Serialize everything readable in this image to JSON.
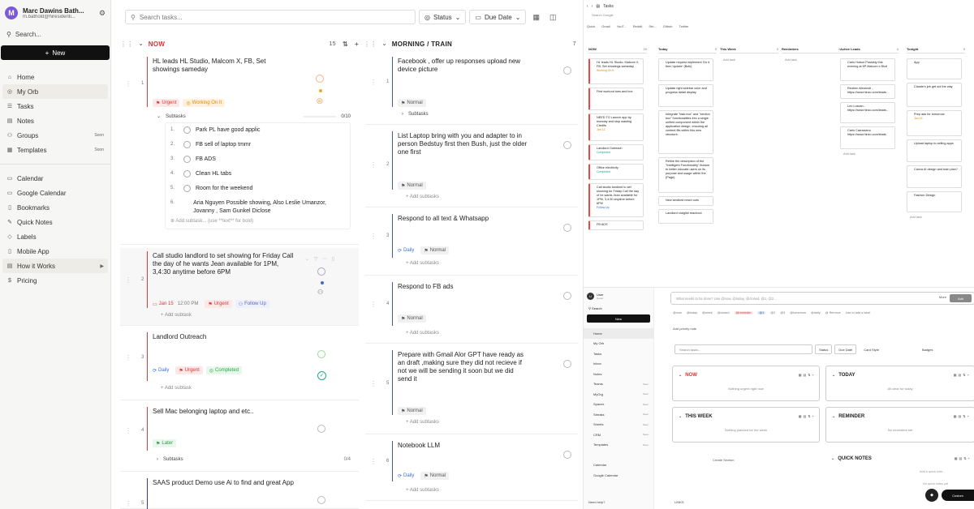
{
  "sidebar": {
    "avatar_letter": "M",
    "user_name": "Marc Dawins Bath...",
    "user_email": "m.bathold@hiresidenti...",
    "search_label": "Search...",
    "new_label": "New",
    "nav1": [
      {
        "label": "Home",
        "icon": "home-icon",
        "glyph": "⌂",
        "tag": ""
      },
      {
        "label": "My Orb",
        "icon": "orb-icon",
        "glyph": "◎",
        "tag": "",
        "active": true
      },
      {
        "label": "Tasks",
        "icon": "tasks-icon",
        "glyph": "☰",
        "tag": ""
      },
      {
        "label": "Notes",
        "icon": "notes-icon",
        "glyph": "▤",
        "tag": ""
      },
      {
        "label": "Groups",
        "icon": "groups-icon",
        "glyph": "⚇",
        "tag": "Soon"
      },
      {
        "label": "Templates",
        "icon": "templates-icon",
        "glyph": "▦",
        "tag": "Soon"
      }
    ],
    "nav2": [
      {
        "label": "Calendar",
        "icon": "calendar-icon",
        "glyph": "▭"
      },
      {
        "label": "Google Calendar",
        "icon": "google-calendar-icon",
        "glyph": "▭"
      },
      {
        "label": "Bookmarks",
        "icon": "bookmark-icon",
        "glyph": "▯"
      },
      {
        "label": "Quick Notes",
        "icon": "quick-notes-icon",
        "glyph": "✎"
      },
      {
        "label": "Labels",
        "icon": "label-icon",
        "glyph": "◇"
      },
      {
        "label": "Mobile App",
        "icon": "mobile-icon",
        "glyph": "▯"
      },
      {
        "label": "How it Works",
        "icon": "book-icon",
        "glyph": "▤",
        "active": true
      },
      {
        "label": "Pricing",
        "icon": "pricing-icon",
        "glyph": "$"
      }
    ]
  },
  "toolbar": {
    "search_placeholder": "Search tasks...",
    "status_label": "Status",
    "due_label": "Due Date"
  },
  "now_col": {
    "title": "NOW",
    "count": "15",
    "cards": [
      {
        "num": "1",
        "title": "HL leads HL Studio, Malcom X, FB, Set showings sameday",
        "urgent": "Urgent",
        "working": "Working On It",
        "subtasks_label": "Subtasks",
        "subtasks_progress": "0/10"
      },
      {
        "num": "2",
        "title": "Call studio landlord to set showing for Friday Call the day of he wants Jean available for 1PM, 3,4:30 anytime before 6PM",
        "date": "Jan 15",
        "time": "12:00 PM",
        "urgent": "Urgent",
        "follow": "Follow Up",
        "add": "Add subtask"
      },
      {
        "num": "3",
        "title": "Landlord Outreach",
        "daily": "Daily",
        "urgent": "Urgent",
        "completed": "Completed",
        "add": "Add subtask"
      },
      {
        "num": "4",
        "title": "Sell Mac belonging laptop and etc..",
        "later": "Later",
        "subtasks_label": "Subtasks",
        "subtasks_progress": "0/4"
      },
      {
        "num": "5",
        "title": "SAAS product Demo use Ai to find and great App"
      }
    ],
    "subtasks": [
      {
        "n": "1.",
        "t": "Park PL have good applic"
      },
      {
        "n": "2.",
        "t": "FB sell of laptop tmmr"
      },
      {
        "n": "3.",
        "t": "FB ADS"
      },
      {
        "n": "4.",
        "t": "Clean HL tabs"
      },
      {
        "n": "5.",
        "t": "Room for the weekend"
      },
      {
        "n": "6.",
        "t": "Aria Nguyen Possible showing, Also Leslie Umanzor,  Jovanny , Sam Gunkel Diclose"
      }
    ],
    "add_subtask_placeholder": "Add subtask... (use **text** for bold)"
  },
  "morning_col": {
    "title": "MORNING / TRAIN",
    "count": "7",
    "cards": [
      {
        "num": "1",
        "title": "Facebook , offer up responses upload new device picture",
        "normal": "Normal",
        "subtasks_label": "Subtasks"
      },
      {
        "num": "2",
        "title": "List Laptop bring with you and adapter to in person Bedstuy first then Bush, just the older one first",
        "normal": "Normal",
        "add": "Add subtasks"
      },
      {
        "num": "3",
        "title": "Respond to all text & Whatsapp",
        "daily": "Daily",
        "normal": "Normal",
        "add": "Add subtasks"
      },
      {
        "num": "4",
        "title": "Respond to FB ads",
        "normal": "Normal",
        "add": "Add subtasks"
      },
      {
        "num": "5",
        "title": "Prepare with Gmail Alor GPT have ready as an draft ,making sure they did not recieve if not we will be sending it soon but we did send it",
        "normal": "Normal",
        "add": "Add subtasks"
      },
      {
        "num": "6",
        "title": "Notebook LLM",
        "daily": "Daily",
        "normal": "Normal",
        "add": "Add subtasks"
      }
    ]
  },
  "board_shot": {
    "title": "Tasks",
    "search": "Search Google",
    "quick": [
      "Quick",
      "Gmail",
      "YouT...",
      "Reddit",
      "Stri...",
      "Github",
      "Twitter"
    ],
    "columns": [
      {
        "name": "NOW",
        "count": "20",
        "cards": [
          {
            "t": "HL leads HL Studio, Malcom X, FB, Set showings sameday",
            "tag": "Working On It",
            "cls": "bo",
            "h": 32
          },
          {
            "t": "First workout toes and box",
            "h": 28
          },
          {
            "t": "NEED TO Launch app by monday and stop wasting Credits",
            "tag": "Jan 13",
            "cls": "bo",
            "h": 34
          },
          {
            "t": "Landlord Outreach",
            "tag": "Completed",
            "cls": "bt",
            "h": 20
          },
          {
            "t": "Office electricity",
            "tag": "Completed",
            "cls": "bt",
            "h": 20
          },
          {
            "t": "Call studio landlord to set showing for Friday Call the day of he wants Jean available for 1PM, 3,4:30 anytime before 6PM",
            "tag": "Follow Up",
            "cls": "bb",
            "h": 42
          },
          {
            "t": "FB ADS",
            "h": 12
          }
        ]
      },
      {
        "name": "Today",
        "count": "0",
        "cards": [
          {
            "t": "Update request implement 'Do it then Update' (Bulk)",
            "h": 28
          },
          {
            "t": "Update right sidebar color and progress detail display",
            "h": 28
          },
          {
            "t": "Integrate \"task box\" and \"section box\" functionalities into a single unified component within the application design, ensuring all content fits within this new structure.",
            "h": 54
          },
          {
            "t": "Refine the description of the \"Intelligent Functionality\" feature to better educate users on its purpose and usage within the (Page).",
            "h": 44
          },
          {
            "t": "New landlord reach outs",
            "h": 12
          },
          {
            "t": "Landlord craiglist reachout",
            "h": 18
          }
        ]
      },
      {
        "name": "This Week",
        "count": "0",
        "cards": []
      },
      {
        "name": "Reminders",
        "count": "0",
        "cards": []
      },
      {
        "name": "Active Leads",
        "count": "4",
        "cards": [
          {
            "t": "Carlo Hotsor Possibly this evening at 6P Malcom x Blvd",
            "h": 28
          },
          {
            "t": "Reuben Alexandr - https://www.hinzo.com/leads...",
            "h": 18
          },
          {
            "t": "Leo Loscan - https://www.hinzo.com/leads...",
            "h": 26
          },
          {
            "t": "Carlo Carraciano https://www.hinzo.com/leads",
            "h": 28
          }
        ]
      },
      {
        "name": "Tonight",
        "count": "9",
        "cards": [
          {
            "t": "App",
            "h": 26
          },
          {
            "t": "Claude's job get out the way",
            "h": 30
          },
          {
            "t": "Prep ads for tomorrow",
            "tag": "Jan 13",
            "cls": "bo",
            "h": 32
          },
          {
            "t": "Upload laptop to selling apps",
            "h": 28
          },
          {
            "t": "Canva AI design and train plan?",
            "h": 28
          },
          {
            "t": "Fashion Design",
            "h": 26
          }
        ]
      }
    ],
    "add_task": "Add task"
  },
  "dash_shot": {
    "user": "User",
    "user_sub": "Guest",
    "search": "Search",
    "new": "New",
    "nav": [
      {
        "l": "Home",
        "t": "",
        "active": true
      },
      {
        "l": "My Orb",
        "t": ""
      },
      {
        "l": "Tasks",
        "t": ""
      },
      {
        "l": "Inbox",
        "t": ""
      },
      {
        "l": "Notes",
        "t": ""
      },
      {
        "l": "Teams",
        "t": "Soon"
      },
      {
        "l": "MyOrg",
        "t": "Soon"
      },
      {
        "l": "Spaces",
        "t": "Soon"
      },
      {
        "l": "Streaks",
        "t": "Soon"
      },
      {
        "l": "Sheets",
        "t": "Soon"
      },
      {
        "l": "CRM",
        "t": "Soon"
      },
      {
        "l": "Templates",
        "t": "Soon"
      },
      {
        "l": "",
        "t": ""
      },
      {
        "l": "Calendar",
        "t": ""
      },
      {
        "l": "Google Calendar",
        "t": ""
      }
    ],
    "input_placeholder": "What needs to be done? Use @now, @today, @closed, @1, @2...",
    "more": "More",
    "add": "Add",
    "chips": [
      "@now",
      "@today",
      "@week",
      "@closed",
      "@reminder",
      "@1",
      "@2",
      "@3",
      "@tomorrow",
      "@daily",
      "@ Remove",
      "Use to add a label"
    ],
    "add_priority_note": "Add priority note",
    "search_tasks": "Search tasks...",
    "status": "Status",
    "due": "Due Date",
    "card_style": "Card Style",
    "badges": "Badges",
    "sections": [
      {
        "title": "NOW",
        "empty": "Nothing urgent right now"
      },
      {
        "title": "TODAY",
        "empty": "All clear for today"
      },
      {
        "title": "THIS WEEK",
        "empty": "Nothing planned for the week"
      },
      {
        "title": "REMINDER",
        "empty": "No reminders set"
      },
      {
        "title": "QUICK NOTES",
        "empty": ""
      }
    ],
    "create_section": "Create Section",
    "quick_note_placeholder": "Add a quick note...",
    "no_quick_notes": "No quick notes yet",
    "links": "LINKS",
    "need_help": "Need help?",
    "custom": "Custom"
  }
}
